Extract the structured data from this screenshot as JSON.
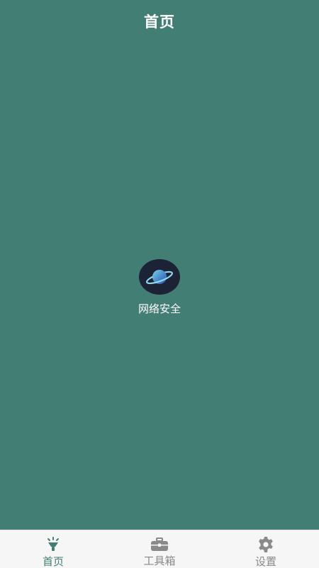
{
  "header": {
    "title": "首页"
  },
  "main": {
    "feature": {
      "label": "网络安全",
      "icon": "planet-icon"
    }
  },
  "tabbar": {
    "items": [
      {
        "label": "首页",
        "icon": "lamp-icon",
        "active": true
      },
      {
        "label": "工具箱",
        "icon": "toolbox-icon",
        "active": false
      },
      {
        "label": "设置",
        "icon": "gear-icon",
        "active": false
      }
    ]
  },
  "colors": {
    "background": "#437e74",
    "accent": "#437e74",
    "tab_inactive": "#8a8a8a",
    "tabbar_bg": "#f6f6f6"
  }
}
